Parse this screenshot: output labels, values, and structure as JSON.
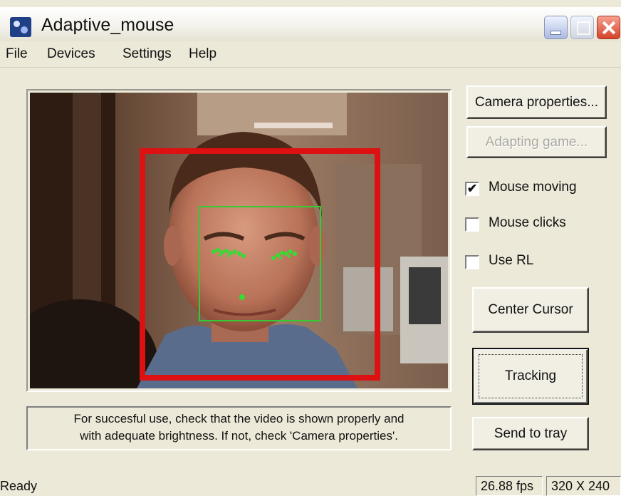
{
  "window": {
    "title": "Adaptive_mouse"
  },
  "menu": [
    "File",
    "Devices",
    "Settings",
    "Help"
  ],
  "buttons": {
    "camera_properties": "Camera properties...",
    "adapting_game": "Adapting game...",
    "center_cursor": "Center Cursor",
    "tracking": "Tracking",
    "send_to_tray": "Send to tray"
  },
  "checkboxes": [
    {
      "label": "Mouse moving",
      "checked": true,
      "mark": "✔"
    },
    {
      "label": "Mouse clicks",
      "checked": false,
      "mark": ""
    },
    {
      "label": "Use RL",
      "checked": false,
      "mark": ""
    }
  ],
  "info": {
    "line1": "For succesful use, check that the video is shown properly and",
    "line2": "with adequate brightness. If not, check 'Camera properties'."
  },
  "status": {
    "text": "Ready",
    "fps": "26.88 fps",
    "resolution": "320 X 240"
  },
  "colors": {
    "face_box": "#dd1111",
    "feature_box": "#33cc33",
    "window_bg": "#ece9d8"
  }
}
